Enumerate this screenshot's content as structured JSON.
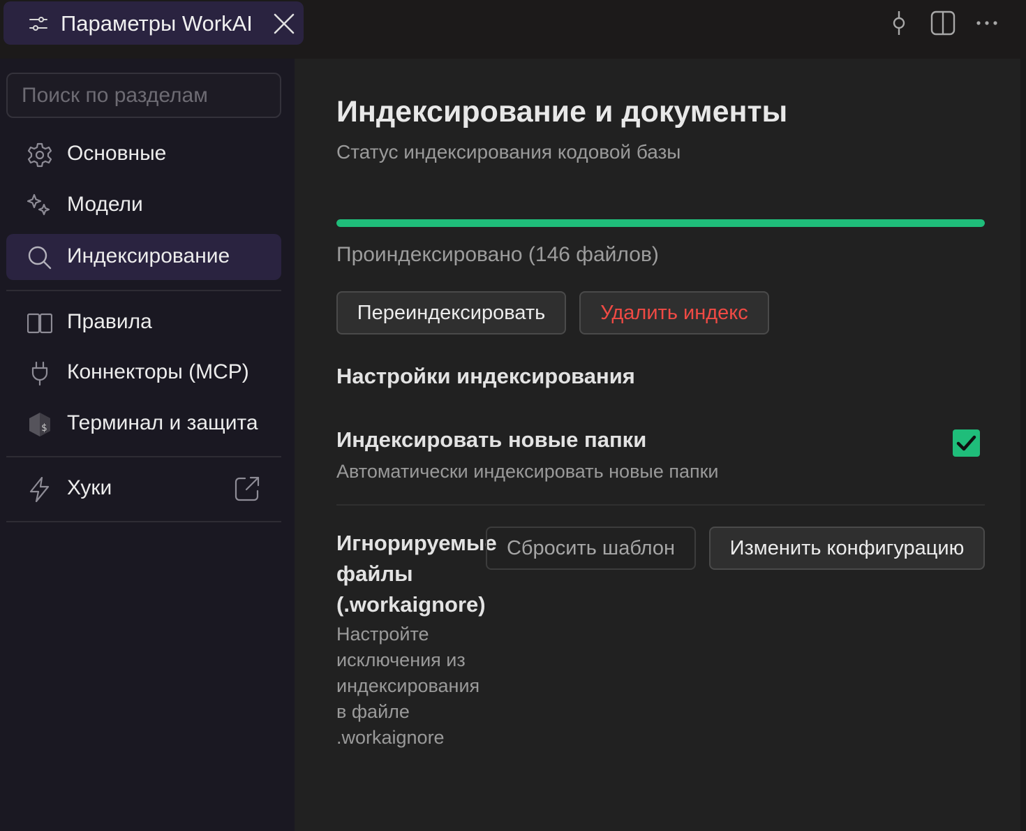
{
  "tab": {
    "title": "Параметры WorkAI"
  },
  "sidebar": {
    "search_placeholder": "Поиск по разделам",
    "items": [
      {
        "label": "Основные",
        "icon": "gear-icon"
      },
      {
        "label": "Модели",
        "icon": "sparkles-icon"
      },
      {
        "label": "Индексирование",
        "icon": "search-icon",
        "active": true
      },
      {
        "label": "Правила",
        "icon": "book-icon"
      },
      {
        "label": "Коннекторы (MCP)",
        "icon": "plug-icon"
      },
      {
        "label": "Терминал и защита",
        "icon": "terminal-shield-icon"
      },
      {
        "label": "Хуки",
        "icon": "lightning-icon",
        "external": true
      }
    ]
  },
  "main": {
    "title": "Индексирование и документы",
    "subtitle": "Статус индексирования кодовой базы",
    "progress_percent": 100,
    "status": "Проиндексировано (146 файлов)",
    "reindex_label": "Переиндексировать",
    "delete_label": "Удалить индекс",
    "settings_title": "Настройки индексирования",
    "index_new": {
      "title": "Индексировать новые папки",
      "description": "Автоматически индексировать новые папки",
      "checked": true
    },
    "ignore": {
      "title": "Игнорируемые файлы (.workaignore)",
      "description": "Настройте исключения из индексирования в файле .workaignore",
      "reset_label": "Сбросить шаблон",
      "edit_label": "Изменить конфигурацию"
    }
  },
  "colors": {
    "accent_green": "#1fbd7a",
    "danger_red": "#f04a44",
    "active_tab_bg": "#2a2340"
  }
}
